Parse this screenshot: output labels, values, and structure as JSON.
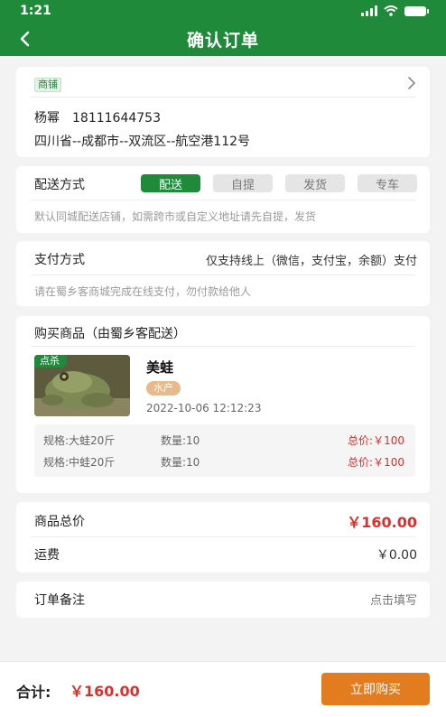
{
  "status_bar": {
    "time": "1:21"
  },
  "header": {
    "title": "确认订单"
  },
  "shop": {
    "tag": "商铺",
    "name": "杨幂",
    "phone": "18111644753",
    "address": "四川省--成都市--双流区--航空港112号"
  },
  "delivery": {
    "label": "配送方式",
    "options": [
      "配送",
      "自提",
      "发货",
      "专车"
    ],
    "selected": "配送",
    "hint": "默认同城配送店铺，如需跨市或自定义地址请先自提，发货"
  },
  "payment": {
    "label": "支付方式",
    "description": "仅支持线上（微信，支付宝，余额）支付",
    "hint": "请在蜀乡客商城完成在线支付，勿付款给他人"
  },
  "goods": {
    "title": "购买商品（由蜀乡客配送）",
    "badge": "点杀",
    "name": "美蛙",
    "category": "水产",
    "time": "2022-10-06 12:12:23",
    "specs": [
      {
        "spec": "规格:大蛙20斤",
        "qty": "数量:10",
        "total": "总价:￥100"
      },
      {
        "spec": "规格:中蛙20斤",
        "qty": "数量:10",
        "total": "总价:￥100"
      }
    ]
  },
  "price": {
    "goods_total_label": "商品总价",
    "goods_total": "￥160.00",
    "freight_label": "运费",
    "freight": "￥0.00"
  },
  "remark": {
    "label": "订单备注",
    "action": "点击填写"
  },
  "footer": {
    "total_label": "合计:",
    "total": "￥160.00",
    "buy_label": "立即购买"
  },
  "colors": {
    "brand_green": "#1f8a3a",
    "price_red": "#d6322e",
    "buy_orange": "#e37b1f"
  }
}
